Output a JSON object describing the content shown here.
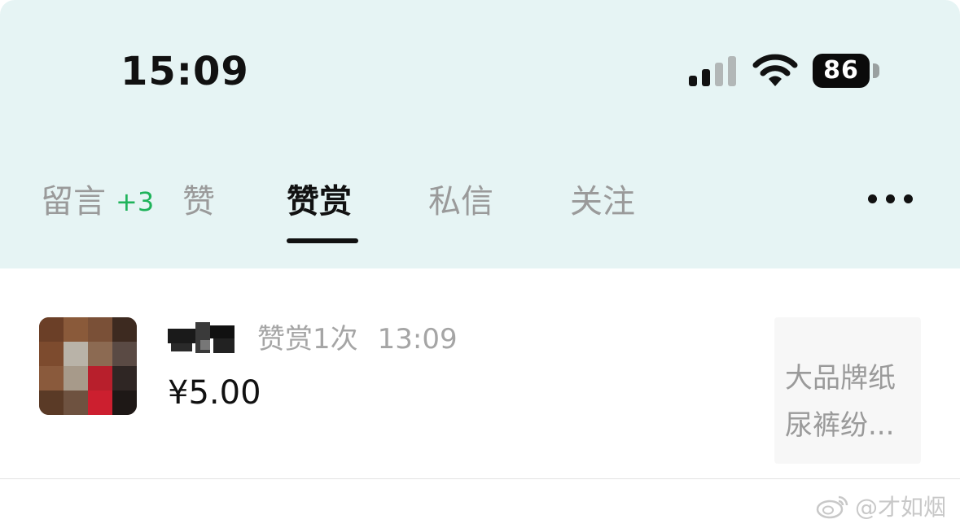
{
  "status_bar": {
    "time": "15:09",
    "battery_level": "86",
    "signal_strength": 2,
    "signal_max": 4
  },
  "tabs": [
    {
      "label": "留言",
      "badge": "+3",
      "active": false
    },
    {
      "label": "赞",
      "active": false
    },
    {
      "label": "赞赏",
      "active": true
    },
    {
      "label": "私信",
      "active": false
    },
    {
      "label": "关注",
      "active": false
    }
  ],
  "more_icon": "more-horizontal-icon",
  "reward_item": {
    "avatar_icon": "avatar-image",
    "username": "",
    "reward_label": "赞赏1次",
    "time": "13:09",
    "amount": "¥5.00",
    "post_preview": [
      "大品牌纸",
      "尿裤纷..."
    ]
  },
  "watermark": {
    "icon": "weibo-icon",
    "text": "@才如烟"
  },
  "colors": {
    "header_bg": "#e6f4f4",
    "badge_green": "#1fb35a",
    "active_text": "#111111",
    "inactive_text": "#9a9a9a"
  }
}
